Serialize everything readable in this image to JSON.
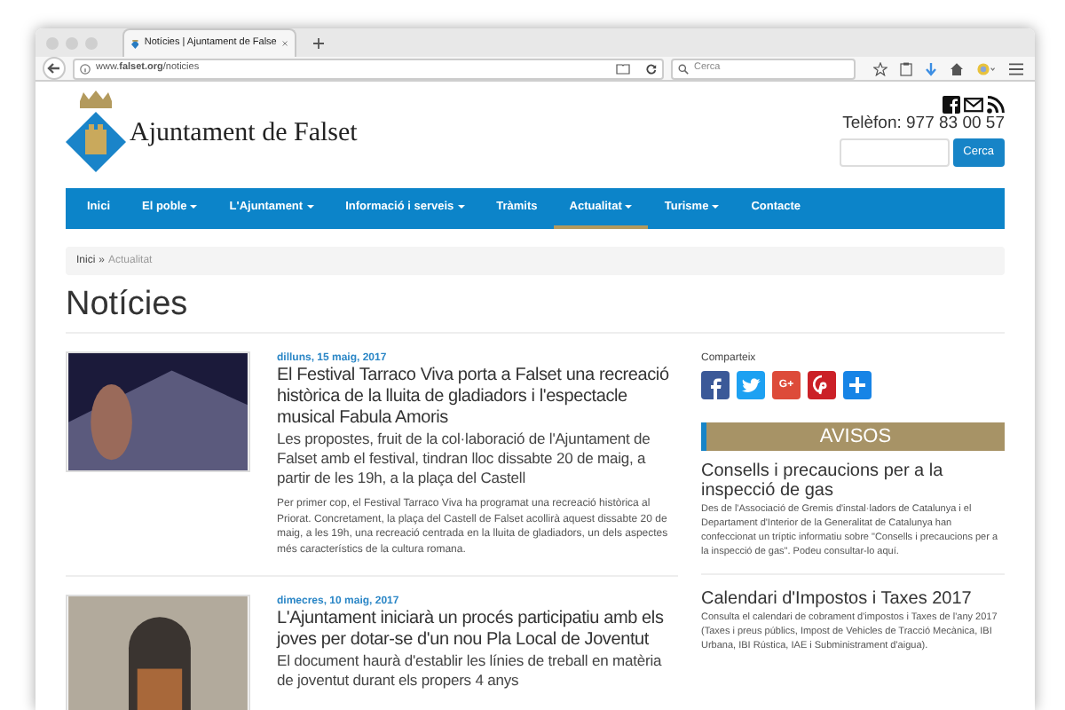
{
  "browser": {
    "tab_title": "Notícies | Ajuntament de False",
    "url": "www.**falset.org**/noticies",
    "search_placeholder": "Cerca"
  },
  "header": {
    "site_name": "Ajuntament de Falset",
    "phone": "Telèfon: 977 83 00 57",
    "search_button": "Cerca"
  },
  "nav": [
    {
      "label": "Inici",
      "dropdown": false,
      "selected": false
    },
    {
      "label": "El poble",
      "dropdown": true,
      "selected": false
    },
    {
      "label": "L'Ajuntament",
      "dropdown": true,
      "selected": false
    },
    {
      "label": "Informació i serveis",
      "dropdown": true,
      "selected": false
    },
    {
      "label": "Tràmits",
      "dropdown": false,
      "selected": false
    },
    {
      "label": "Actualitat",
      "dropdown": true,
      "selected": true
    },
    {
      "label": "Turisme",
      "dropdown": true,
      "selected": false
    },
    {
      "label": "Contacte",
      "dropdown": false,
      "selected": false
    }
  ],
  "breadcrumb": {
    "items": [
      "Inici",
      "Actualitat"
    ],
    "separator": "»"
  },
  "page_title": "Notícies",
  "articles": [
    {
      "kind": "night",
      "date": "dilluns, 15 maig, 2017",
      "title": "El Festival Tarraco Viva porta a Falset una recreació històrica de la lluita de gladiadors i l'espectacle musical Fabula Amoris",
      "subtitle": "Les propostes, fruit de la col·laboració de l'Ajuntament de Falset amb el festival, tindran lloc dissabte 20 de maig, a partir de les 19h, a la plaça del Castell",
      "body": "Per primer cop, el Festival Tarraco Viva ha programat una recreació històrica al Priorat. Concretament, la plaça del Castell de Falset acollirà aquest dissabte 20 de maig, a les 19h, una recreació centrada en la lluita de gladiadors, un dels aspectes més característics de la cultura romana."
    },
    {
      "kind": "building",
      "date": "dimecres, 10 maig, 2017",
      "title": "L'Ajuntament iniciarà un procés participatiu amb els joves per dotar-se d'un nou Pla Local de Joventut",
      "subtitle": "El document haurà d'establir les línies de treball en matèria de joventut durant els propers 4 anys"
    }
  ],
  "sidebar": {
    "share_label": "Comparteix",
    "share_buttons": [
      {
        "kind": "facebook"
      },
      {
        "kind": "twitter"
      },
      {
        "kind": "googleplus",
        "glyph": "G+"
      },
      {
        "kind": "pinterest"
      },
      {
        "kind": "add"
      }
    ],
    "notices_heading": "AVISOS",
    "notices": [
      {
        "title": "Consells i precaucions per a la inspecció de gas",
        "body": "Des de l'Associació de Gremis d'instal·ladors de Catalunya i el Departament d'Interior de la Generalitat de Catalunya han confeccionat un tríptic informatiu sobre \"Consells i precaucions per a la inspecció de gas\". Podeu consultar-lo aquí."
      },
      {
        "title": "Calendari d'Impostos i Taxes 2017",
        "body": "Consulta el calendari de cobrament d'impostos i Taxes de l'any 2017 (Taxes i preus públics, Impost de Vehicles de Tracció Mecànica, IBI Urbana, IBI Rústica, IAE i Subministrament d'aigua)."
      }
    ]
  }
}
